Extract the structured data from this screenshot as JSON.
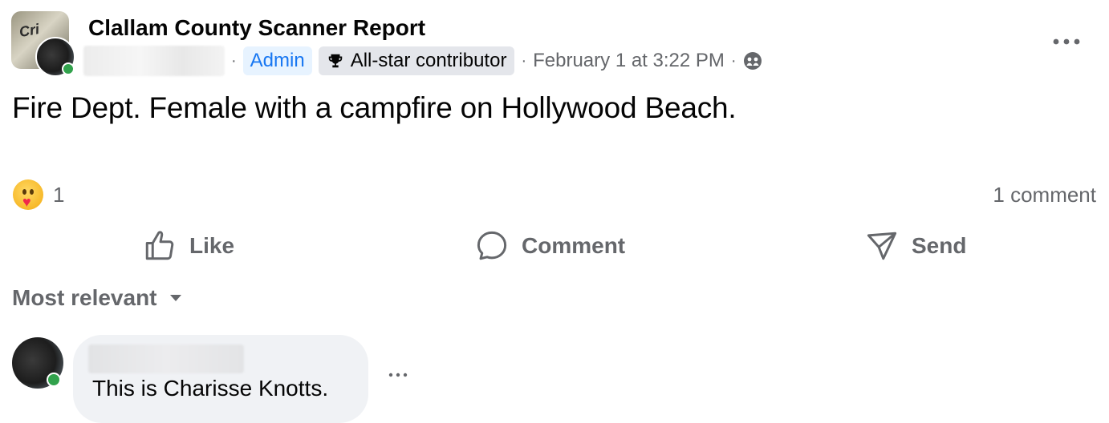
{
  "post": {
    "group_name": "Clallam County Scanner Report",
    "group_avatar_text": "Cri",
    "author_name_hidden": "",
    "separator": "·",
    "role_badge": "Admin",
    "contributor_badge": "All-star contributor",
    "timestamp": "February 1 at 3:22 PM",
    "audience_icon": "group-audience-icon",
    "text": "Fire Dept. Female with a campfire on Hollywood Beach."
  },
  "reactions": {
    "emoji_icon": "care-reaction-icon",
    "count": "1",
    "comment_count": "1 comment"
  },
  "actions": {
    "like_label": "Like",
    "comment_label": "Comment",
    "send_label": "Send"
  },
  "comments": {
    "sort_label": "Most relevant",
    "items": [
      {
        "author_hidden": "",
        "text": "This is Charisse Knotts."
      }
    ]
  },
  "colors": {
    "text_primary": "#050505",
    "text_secondary": "#65676b",
    "accent_blue": "#1877f2",
    "admin_badge_bg": "#e7f3ff",
    "badge_bg": "#e4e6eb",
    "bubble_bg": "#f0f2f5",
    "online_green": "#31a24c"
  }
}
